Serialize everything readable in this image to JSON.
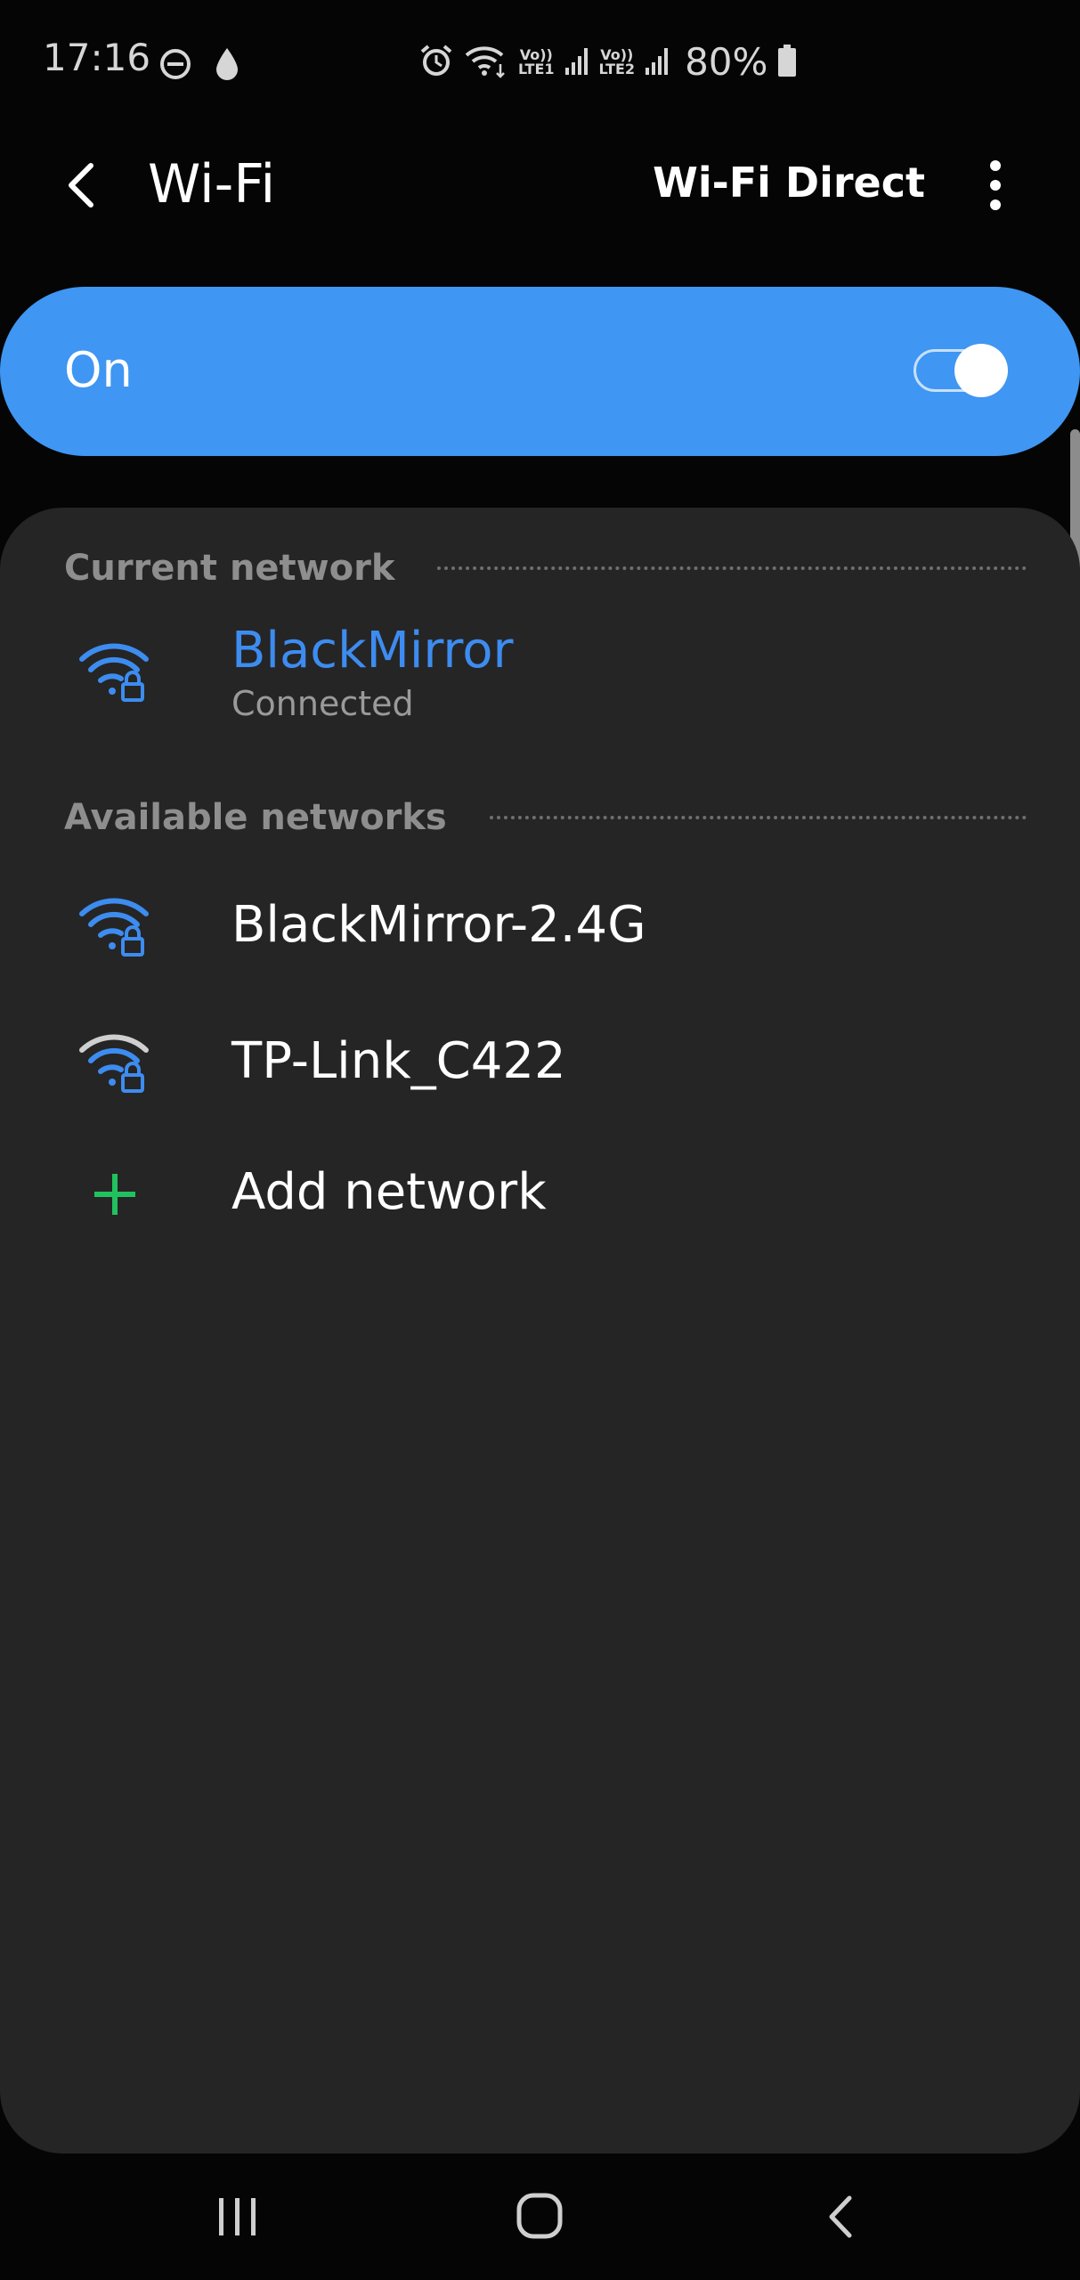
{
  "status_bar": {
    "time": "17:16",
    "battery_percent": "80%",
    "sim1_label": "LTE1",
    "sim2_label": "LTE2",
    "volte_label": "Vo))",
    "icons": [
      "do-not-disturb-icon",
      "drop-icon",
      "alarm-icon",
      "wifi-data-icon",
      "signal-icon",
      "battery-icon"
    ]
  },
  "header": {
    "title": "Wi-Fi",
    "wifi_direct_label": "Wi-Fi Direct"
  },
  "master_toggle": {
    "label": "On",
    "state": true
  },
  "current_network": {
    "section_label": "Current network",
    "name": "BlackMirror",
    "status": "Connected"
  },
  "available_networks": {
    "section_label": "Available networks",
    "items": [
      {
        "name": "BlackMirror-2.4G",
        "secured": true
      },
      {
        "name": "TP-Link_C422",
        "secured": true
      }
    ],
    "add_label": "Add network"
  },
  "colors": {
    "accent": "#3f96f3",
    "connected_text": "#3d8cf0",
    "card_background": "#252525",
    "page_background": "#050505",
    "add_icon": "#21c25e"
  }
}
